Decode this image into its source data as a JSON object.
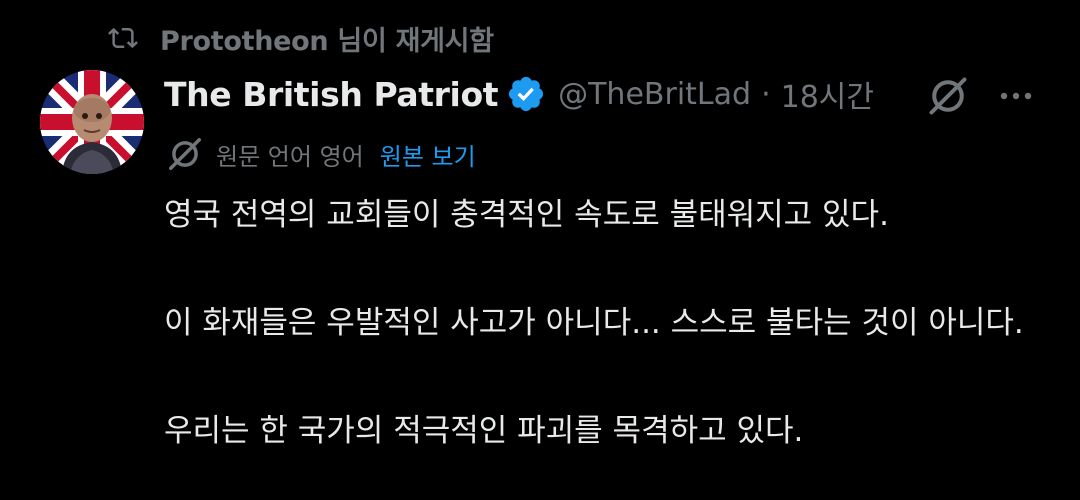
{
  "repost": {
    "label": "Prototheon 님이 재게시함",
    "icon": "repost-icon"
  },
  "author": {
    "display_name": "The British Patriot",
    "handle": "@TheBritLad",
    "separator": "·",
    "time": "18시간",
    "verified": true,
    "avatar_icon": "avatar-union-jack-portrait"
  },
  "actions": {
    "grok_icon": "grok-icon",
    "more_icon": "more-dots-icon"
  },
  "translation": {
    "label": "원문 언어 영어",
    "link": "원본 보기"
  },
  "post": {
    "paragraphs": [
      "영국 전역의 교회들이 충격적인 속도로 불태워지고 있다.",
      "이 화재들은 우발적인 사고가 아니다... 스스로 불타는 것이 아니다.",
      "우리는 한 국가의 적극적인 파괴를 목격하고 있다."
    ]
  },
  "colors": {
    "background": "#000000",
    "text": "#e7e9ea",
    "muted": "#71767b",
    "accent": "#1d9bf0"
  }
}
